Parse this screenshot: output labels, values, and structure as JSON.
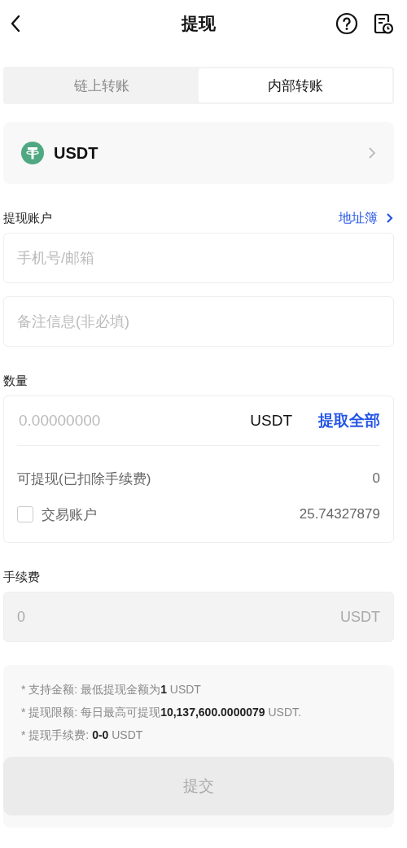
{
  "header": {
    "title": "提现"
  },
  "tabs": [
    {
      "label": "链上转账",
      "selected": false
    },
    {
      "label": "内部转账",
      "selected": true
    }
  ],
  "coin": {
    "name": "USDT"
  },
  "account": {
    "label": "提现账户",
    "link": "地址簿",
    "fields": [
      {
        "placeholder": "手机号/邮箱"
      },
      {
        "placeholder": "备注信息(非必填)"
      }
    ]
  },
  "amount": {
    "label": "数量",
    "placeholder": "0.00000000",
    "unit": "USDT",
    "max_button": "提取全部",
    "available_label": "可提现(已扣除手续费)",
    "available_value": "0",
    "trading_account": {
      "label": "交易账户",
      "checked": false,
      "value": "25.74327879"
    }
  },
  "fee": {
    "label": "手续费",
    "value": "0",
    "unit": "USDT"
  },
  "notes": [
    "* 支持金额: 最低提现金额为**1** USDT",
    "* 提现限额: 每日最高可提现**10,137,600.0000079** USDT.",
    "* 提现手续费: **0-0** USDT"
  ],
  "submit": {
    "label": "提交",
    "disabled": true
  }
}
